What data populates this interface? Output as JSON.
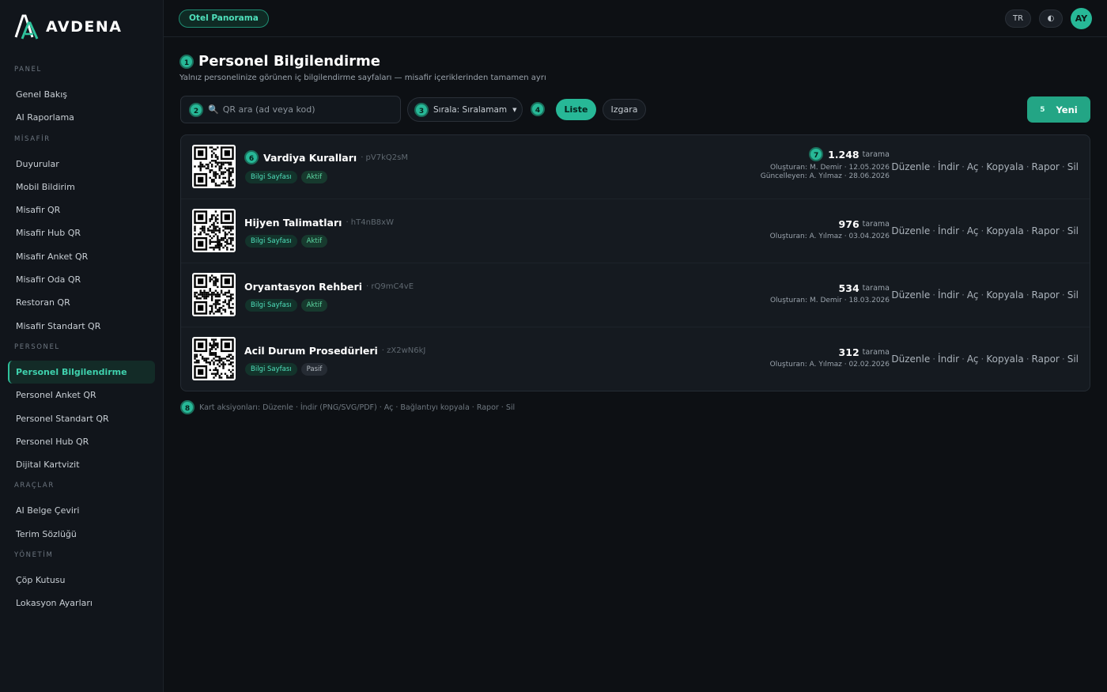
{
  "brand": {
    "name": "AVDENA"
  },
  "sidebar": {
    "sections": [
      {
        "title": "PANEL",
        "items": [
          "Genel Bakış",
          "AI Raporlama"
        ]
      },
      {
        "title": "MİSAFİR",
        "items": [
          "Duyurular",
          "Mobil Bildirim",
          "Misafir QR",
          "Misafir Hub QR",
          "Misafir Anket QR",
          "Misafir Oda QR",
          "Restoran QR",
          "Misafir Standart QR"
        ]
      },
      {
        "title": "PERSONEL",
        "items": [
          "Personel Bilgilendirme",
          "Personel Anket QR",
          "Personel Standart QR",
          "Personel Hub QR",
          "Dijital Kartvizit"
        ]
      },
      {
        "title": "ARAÇLAR",
        "items": [
          "AI Belge Çeviri",
          "Terim Sözlüğü"
        ]
      },
      {
        "title": "YÖNETİM",
        "items": [
          "Çöp Kutusu",
          "Lokasyon Ayarları"
        ]
      }
    ],
    "active_item": "Personel Bilgilendirme"
  },
  "topbar": {
    "hotel": "Otel Panorama",
    "lang": "TR",
    "theme_icon": "◐",
    "avatar": "AY"
  },
  "page": {
    "badge": "1",
    "title": "Personel Bilgilendirme",
    "subtitle": "Yalnız personelinize görünen iç bilgilendirme sayfaları — misafir içeriklerinden tamamen ayrı"
  },
  "toolbar": {
    "search_badge": "2",
    "search_placeholder": "QR ara (ad veya kod)",
    "sort_badge": "3",
    "sort_label": "Sırala: Sıralamam",
    "view_badge": "4",
    "view_list": "Liste",
    "view_grid": "Izgara",
    "new_badge": "5",
    "new_label": "Yeni"
  },
  "list": {
    "title_badge": "6",
    "stats_badge": "7",
    "scan_label": "tarama",
    "actions": [
      "Düzenle",
      "İndir",
      "Aç",
      "Kopyala",
      "Rapor",
      "Sil"
    ],
    "items": [
      {
        "title": "Vardiya Kuralları",
        "code": "· pV7kQ2sM",
        "type": "Bilgi Sayfası",
        "status": "Aktif",
        "scans": "1.248",
        "created": "Oluşturan: M. Demir · 12.05.2026",
        "updated": "Güncelleyen: A. Yılmaz · 28.06.2026"
      },
      {
        "title": "Hijyen Talimatları",
        "code": "· hT4nB8xW",
        "type": "Bilgi Sayfası",
        "status": "Aktif",
        "scans": "976",
        "created": "Oluşturan: A. Yılmaz · 03.04.2026"
      },
      {
        "title": "Oryantasyon Rehberi",
        "code": "· rQ9mC4vE",
        "type": "Bilgi Sayfası",
        "status": "Aktif",
        "scans": "534",
        "created": "Oluşturan: M. Demir · 18.03.2026"
      },
      {
        "title": "Acil Durum Prosedürleri",
        "code": "· zX2wN6kJ",
        "type": "Bilgi Sayfası",
        "status": "Pasif",
        "scans": "312",
        "created": "Oluşturan: A. Yılmaz · 02.02.2026"
      }
    ]
  },
  "footnote": {
    "badge": "8",
    "text": "Kart aksiyonları: Düzenle · İndir (PNG/SVG/PDF) · Aç · Bağlantıyı kopyala · Rapor · Sil"
  },
  "colors": {
    "accent": "#27b897",
    "background": "#0d1014",
    "sidebar": "#11151b"
  }
}
